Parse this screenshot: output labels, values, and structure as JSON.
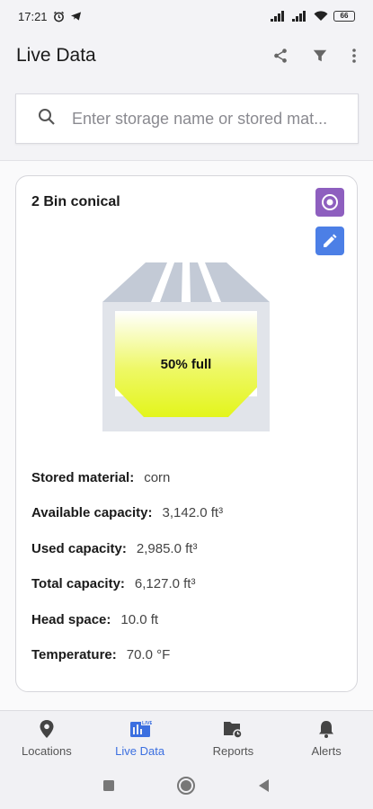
{
  "status": {
    "time": "17:21",
    "battery": "66"
  },
  "app": {
    "title": "Live Data"
  },
  "search": {
    "placeholder": "Enter storage name or stored mat..."
  },
  "card": {
    "title": "2 Bin conical",
    "fill_percent": 50,
    "fill_label": "50% full",
    "details": [
      {
        "label": "Stored material:",
        "value": "corn"
      },
      {
        "label": "Available capacity:",
        "value": "3,142.0 ft³"
      },
      {
        "label": "Used capacity:",
        "value": "2,985.0 ft³"
      },
      {
        "label": "Total capacity:",
        "value": "6,127.0 ft³"
      },
      {
        "label": "Head space:",
        "value": "10.0 ft"
      },
      {
        "label": "Temperature:",
        "value": "70.0 °F"
      }
    ]
  },
  "nav": [
    {
      "label": "Locations",
      "icon": "location-pin-icon",
      "active": false
    },
    {
      "label": "Live Data",
      "icon": "live-data-icon",
      "active": true
    },
    {
      "label": "Reports",
      "icon": "reports-icon",
      "active": false
    },
    {
      "label": "Alerts",
      "icon": "bell-icon",
      "active": false
    }
  ],
  "colors": {
    "accent": "#3b6fe0",
    "target_button": "#8e5fbf",
    "edit_button": "#4c7fe6",
    "fill": "#e6f52a"
  }
}
